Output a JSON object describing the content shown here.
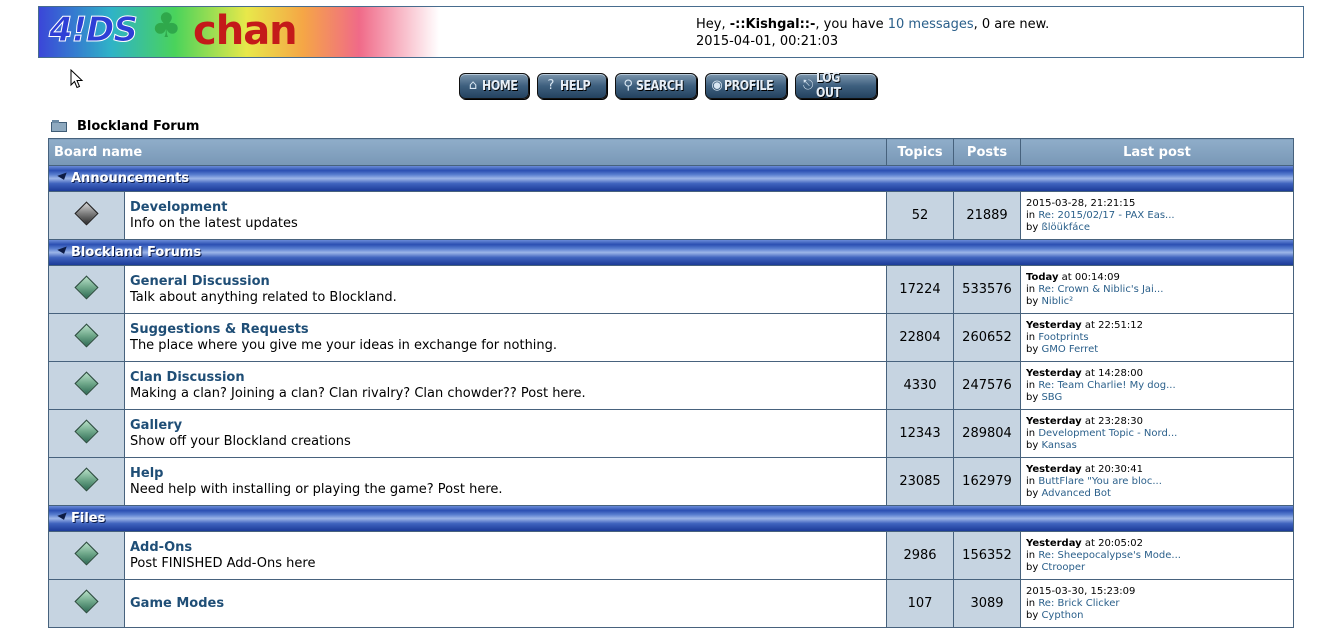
{
  "header": {
    "greeting_prefix": "Hey,",
    "username": "-::Kishgal::-",
    "greeting_mid": ", you have",
    "messages_link": "10 messages",
    "greeting_suffix": ", 0 are new.",
    "datetime": "2015-04-01, 00:21:03",
    "logo_text_a": "4!DS",
    "logo_text_b": "chan"
  },
  "nav": [
    {
      "label": "HOME",
      "icon": "home-icon"
    },
    {
      "label": "HELP",
      "icon": "help-icon"
    },
    {
      "label": "SEARCH",
      "icon": "search-icon"
    },
    {
      "label": "PROFILE",
      "icon": "profile-icon"
    },
    {
      "label": "LOG OUT",
      "icon": "logout-icon"
    }
  ],
  "breadcrumb": "Blockland Forum",
  "columns": {
    "board": "Board name",
    "topics": "Topics",
    "posts": "Posts",
    "last": "Last post"
  },
  "categories": [
    {
      "title": "Announcements",
      "boards": [
        {
          "name": "Development",
          "desc": "Info on the latest updates",
          "topics": "52",
          "posts": "21889",
          "last_when_bold": "",
          "last_when": "2015-03-28, 21:21:15",
          "last_topic": "Re: 2015/02/17 - PAX Eas...",
          "last_user": "ßlöükfáce",
          "icon": "grey"
        }
      ]
    },
    {
      "title": "Blockland Forums",
      "boards": [
        {
          "name": "General Discussion",
          "desc": "Talk about anything related to Blockland.",
          "topics": "17224",
          "posts": "533576",
          "last_when_bold": "Today",
          "last_when": " at 00:14:09",
          "last_topic": "Re: Crown & Niblic's Jai...",
          "last_user": "Niblic²",
          "icon": "green"
        },
        {
          "name": "Suggestions & Requests",
          "desc": "The place where you give me your ideas in exchange for nothing.",
          "topics": "22804",
          "posts": "260652",
          "last_when_bold": "Yesterday",
          "last_when": " at 22:51:12",
          "last_topic": "Footprints",
          "last_user": "GMO Ferret",
          "icon": "green"
        },
        {
          "name": "Clan Discussion",
          "desc": "Making a clan? Joining a clan? Clan rivalry? Clan chowder?? Post here.",
          "topics": "4330",
          "posts": "247576",
          "last_when_bold": "Yesterday",
          "last_when": " at 14:28:00",
          "last_topic": "Re: Team Charlie! My dog...",
          "last_user": "SBG",
          "icon": "green"
        },
        {
          "name": "Gallery",
          "desc": "Show off your Blockland creations",
          "topics": "12343",
          "posts": "289804",
          "last_when_bold": "Yesterday",
          "last_when": " at 23:28:30",
          "last_topic": "Development Topic - Nord...",
          "last_user": "Kansas",
          "icon": "green"
        },
        {
          "name": "Help",
          "desc": "Need help with installing or playing the game? Post here.",
          "topics": "23085",
          "posts": "162979",
          "last_when_bold": "Yesterday",
          "last_when": " at 20:30:41",
          "last_topic": "ButtFlare \"You are bloc...",
          "last_user": "Advanced Bot",
          "icon": "green"
        }
      ]
    },
    {
      "title": "Files",
      "boards": [
        {
          "name": "Add-Ons",
          "desc": "Post FINISHED Add-Ons here",
          "topics": "2986",
          "posts": "156352",
          "last_when_bold": "Yesterday",
          "last_when": " at 20:05:02",
          "last_topic": "Re: Sheepocalypse's Mode...",
          "last_user": "Ctrooper",
          "icon": "green"
        },
        {
          "name": "Game Modes",
          "desc": "",
          "topics": "107",
          "posts": "3089",
          "last_when_bold": "",
          "last_when": "2015-03-30, 15:23:09",
          "last_topic": "Re: Brick Clicker",
          "last_user": "Cypthon",
          "icon": "green"
        }
      ]
    }
  ],
  "last_in_label": "in",
  "last_by_label": "by"
}
